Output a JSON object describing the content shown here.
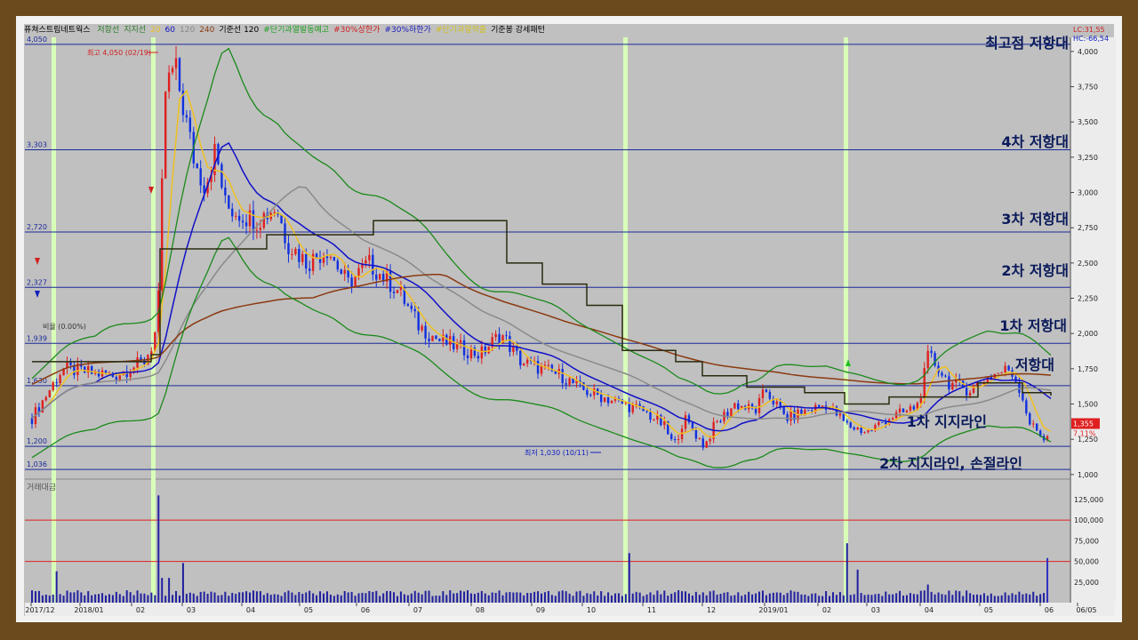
{
  "legend": {
    "stock_name": "퓨쳐스트림네트웍스",
    "items": [
      {
        "label": "저항선",
        "color": "#2b7a2b"
      },
      {
        "label": "지지선",
        "color": "#2b7a2b"
      },
      {
        "label": "20",
        "color": "#e8c020"
      },
      {
        "label": "60",
        "color": "#1010c0"
      },
      {
        "label": "120",
        "color": "#888888"
      },
      {
        "label": "240",
        "color": "#8b3a10"
      },
      {
        "label": "기준선 120",
        "color": "#000000"
      },
      {
        "label": "#단기과열발동예고",
        "color": "#20a020"
      },
      {
        "label": "#30%상한가",
        "color": "#d02020"
      },
      {
        "label": "#30%하한가",
        "color": "#2020c0"
      },
      {
        "label": "#단기과열적출",
        "color": "#d0c020"
      },
      {
        "label": "기준봉 강세패턴",
        "color": "#000000"
      }
    ],
    "lc": "LC:31,55",
    "hc": "HC:-66,54"
  },
  "colors": {
    "up": "#e02020",
    "down": "#1030e0",
    "ma20": "#f0c020",
    "ma60": "#1010c8",
    "ma120": "#8a8a8a",
    "ma240": "#8b3a10",
    "baseline": "#2a2a10",
    "bands": "#1a8a1a",
    "hlines": "#1a2a9a",
    "highlight": "#d8ffb8",
    "vol_red": "#e02020"
  },
  "chart_data": {
    "type": "candlestick",
    "y_ticks": [
      "4,000",
      "3,750",
      "3,500",
      "3,250",
      "3,000",
      "2,750",
      "2,500",
      "2,250",
      "2,000",
      "1,750",
      "1,500",
      "1,250",
      "1,000"
    ],
    "x_ticks": [
      "2017/12",
      "2018/01",
      "02",
      "03",
      "04",
      "05",
      "06",
      "07",
      "08",
      "09",
      "10",
      "11",
      "12",
      "2019/01",
      "02",
      "03",
      "04",
      "05",
      "06",
      "06/05"
    ],
    "levels": [
      {
        "value": 4050,
        "label": "4,050",
        "annotation": "최고점 저항대"
      },
      {
        "value": 3303,
        "label": "3,303",
        "annotation": "4차 저항대"
      },
      {
        "value": 2720,
        "label": "2,720",
        "annotation": "3차 저항대"
      },
      {
        "value": 2327,
        "label": "2,327",
        "annotation": "2차 저항대"
      },
      {
        "value": 1930,
        "label": "1,939",
        "annotation": "1차 저항대"
      },
      {
        "value": 1630,
        "label": "1,630",
        "annotation": "저항대"
      },
      {
        "value": 1200,
        "label": "1,200",
        "annotation": "1차 지지라인"
      },
      {
        "value": 1036,
        "label": "1,036",
        "annotation": "2차 지지라인, 손절라인"
      }
    ],
    "high_marker": "최고 4,050 (02/19)",
    "low_marker": "최저 1,030 (10/11)",
    "ratio_marker": "비율 (0.00%)",
    "current_price": "1,355",
    "current_change": "7.11%",
    "volume": {
      "title": "거래대금",
      "y_ticks": [
        "125,000",
        "100,000",
        "75,000",
        "50,000",
        "25,000"
      ],
      "ref_lines": [
        100000,
        50000
      ]
    }
  }
}
